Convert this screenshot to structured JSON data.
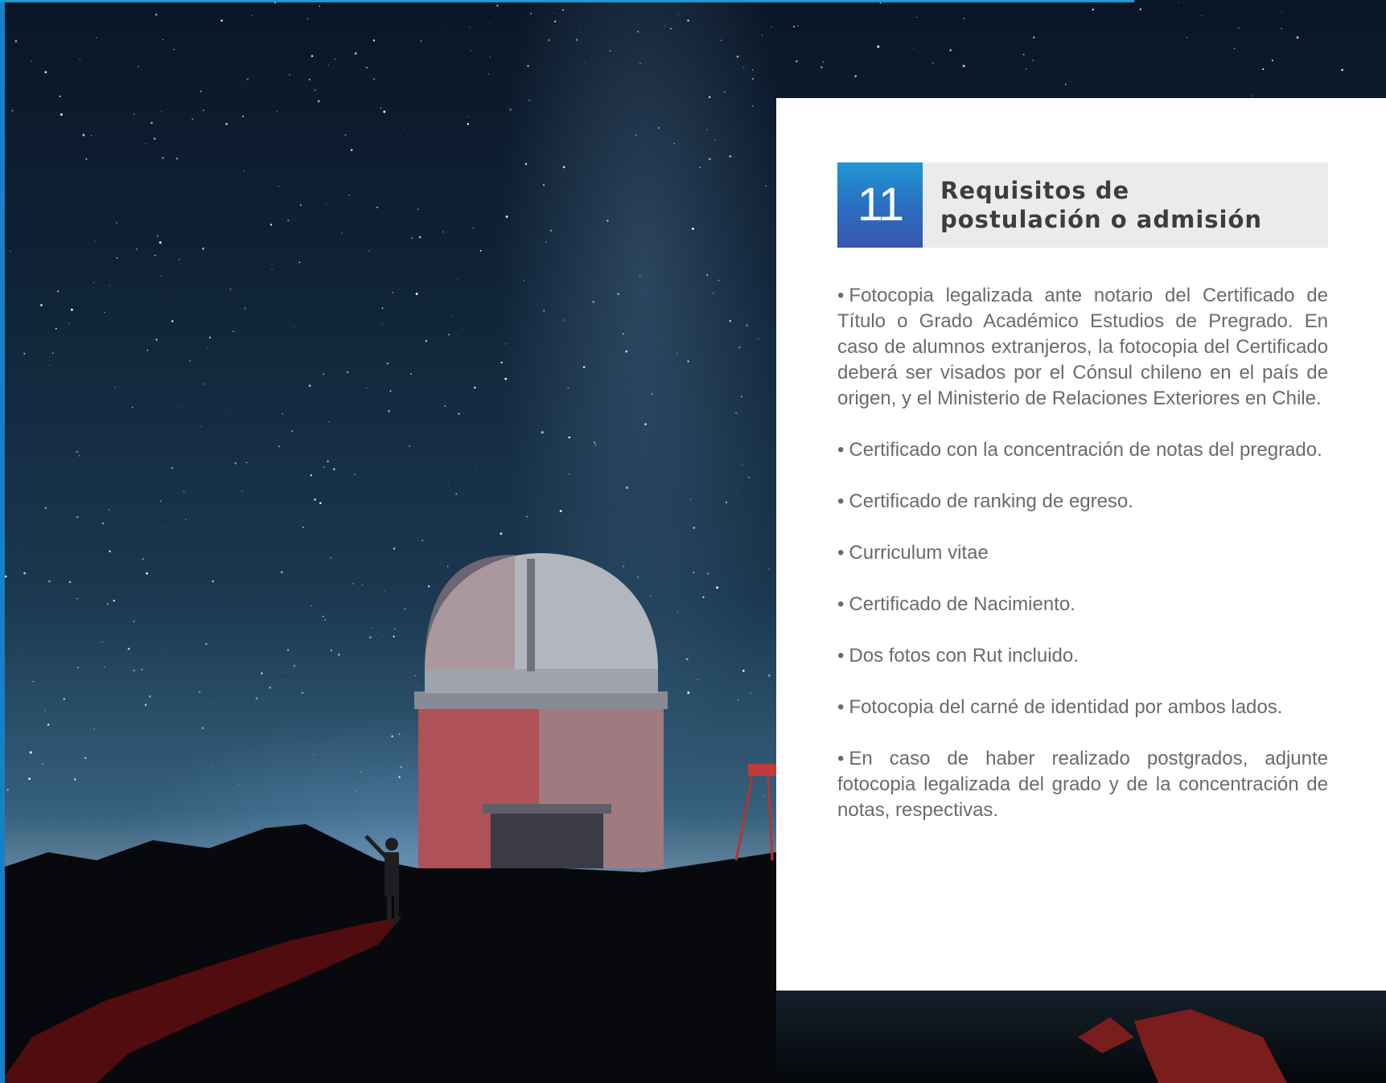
{
  "section": {
    "number": "11",
    "title_line1": "Requisitos de",
    "title_line2": "postulación o admisión"
  },
  "requirements": [
    "Fotocopia legalizada ante notario del Certificado de Título o Grado Académico Estudios de Pregrado. En caso de alumnos extranjeros, la fotocopia del Certificado deberá ser visados por el Cónsul chileno en el país de origen, y el Ministerio de Relaciones Exteriores en Chile.",
    "Certificado con la concentración de notas del pregrado.",
    "Certificado de ranking de egreso.",
    "Curriculum vitae",
    "Certificado de Nacimiento.",
    "Dos fotos con Rut incluido.",
    "Fotocopia del carné de identidad por ambos lados.",
    "En caso de haber realizado postgrados, adjunte fotocopia legalizada del grado y de la concentración de notas, respectivas."
  ],
  "bullet_symbol": "•",
  "colors": {
    "accent_blue": "#1a7fc4",
    "number_box_gradient_top": "#1f97d3",
    "number_box_gradient_bottom": "#3a56ad",
    "title_bg": "#ebebeb",
    "title_text": "#3d3d3d",
    "body_text": "#6b6b6b"
  },
  "background_image": "observatory-dome-under-milky-way"
}
